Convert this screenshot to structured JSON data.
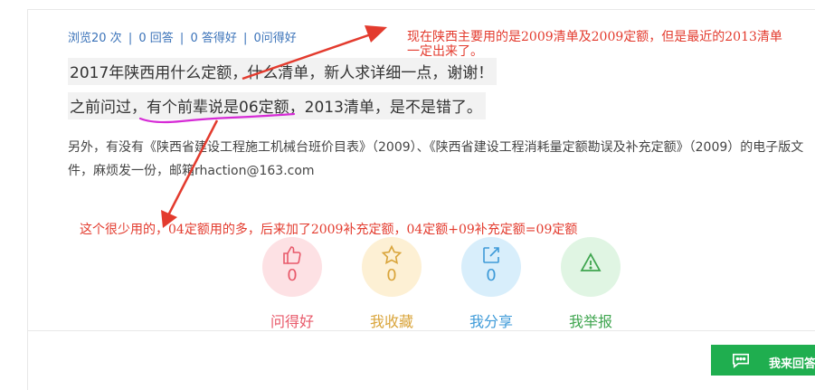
{
  "stats": {
    "views": "浏览20 次",
    "answers": "0 回答",
    "good_answers": "0 答得好",
    "good_questions": "0问得好",
    "separator": "|"
  },
  "question": {
    "line1": "2017年陕西用什么定额，什么清单，新人求详细一点，谢谢！",
    "line2": "之前问过，有个前辈说是06定额，2013清单，是不是错了。",
    "extra": "另外，有没有《陕西省建设工程施工机械台班价目表》（2009）、《陕西省建设工程消耗量定额勘误及补充定额》（2009）的电子版文件，麻烦发一份，邮箱rhaction@163.com"
  },
  "annotations": {
    "note1": "现在陕西主要用的是2009清单及2009定额，但是最近的2013清单一定出来了。",
    "note2": "这个很少用的，04定额用的多，后来加了2009补充定额，04定额+09补充定额=09定额"
  },
  "actions": [
    {
      "label": "问得好",
      "count": "0",
      "icon": "thumbs-up-icon"
    },
    {
      "label": "我收藏",
      "count": "0",
      "icon": "star-icon"
    },
    {
      "label": "我分享",
      "count": "0",
      "icon": "share-icon"
    },
    {
      "label": "我举报",
      "count": "",
      "icon": "warning-icon"
    }
  ],
  "answer_button": {
    "label": "我来回答",
    "icon": "chat-bubble-icon"
  },
  "colors": {
    "link_blue": "#3b73b9",
    "annotation_red": "#e33b2e",
    "underline_magenta": "#d62bd6",
    "good": "#e8596a",
    "collect": "#d9a43a",
    "share": "#3d9ad8",
    "report": "#3fa54f",
    "answer_green": "#1fae4f"
  }
}
